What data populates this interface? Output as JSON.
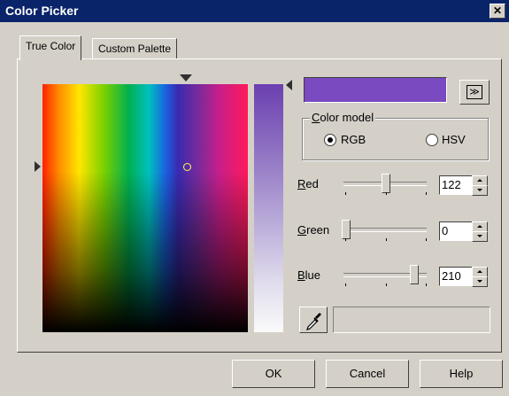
{
  "window": {
    "title": "Color Picker",
    "close_label": "✕"
  },
  "tabs": [
    {
      "label": "True Color"
    },
    {
      "label": "Custom Palette"
    }
  ],
  "expand_button": {
    "label": "≫"
  },
  "color_model": {
    "label_prefix": "C",
    "label_rest": "olor model",
    "options": [
      {
        "label": "RGB",
        "selected": true
      },
      {
        "label": "HSV",
        "selected": false
      }
    ]
  },
  "channels": [
    {
      "accel": "R",
      "rest": "ed",
      "value": "122",
      "fraction": 0.478
    },
    {
      "accel": "G",
      "rest": "reen",
      "value": "0",
      "fraction": 0.0
    },
    {
      "accel": "B",
      "rest": "lue",
      "value": "210",
      "fraction": 0.824
    }
  ],
  "buttons": {
    "ok": "OK",
    "cancel": "Cancel",
    "help": "Help"
  },
  "colors": {
    "current": "#7a4ac0"
  },
  "icons": {
    "picker": "eyedropper-icon",
    "close": "close-icon"
  }
}
